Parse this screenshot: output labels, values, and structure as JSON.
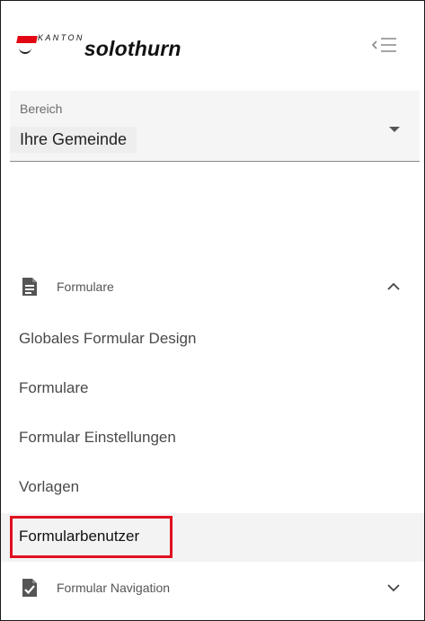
{
  "logo": {
    "kanton": "KANTON",
    "name": "solothurn"
  },
  "header": {
    "collapse_icon": "collapse-menu-icon"
  },
  "bereich": {
    "label": "Bereich",
    "value": "Ihre Gemeinde"
  },
  "sections": {
    "formulare": {
      "label": "Formulare",
      "icon": "document-icon",
      "expanded": true,
      "items": [
        {
          "label": "Globales Formular Design"
        },
        {
          "label": "Formulare"
        },
        {
          "label": "Formular Einstellungen"
        },
        {
          "label": "Vorlagen"
        },
        {
          "label": "Formularbenutzer",
          "active": true
        }
      ]
    },
    "formular_navigation": {
      "label": "Formular Navigation",
      "icon": "document-check-icon",
      "expanded": false
    }
  },
  "colors": {
    "brand_red": "#e30613",
    "highlight": "#e0101f",
    "active_bg": "#f3f3f3"
  }
}
